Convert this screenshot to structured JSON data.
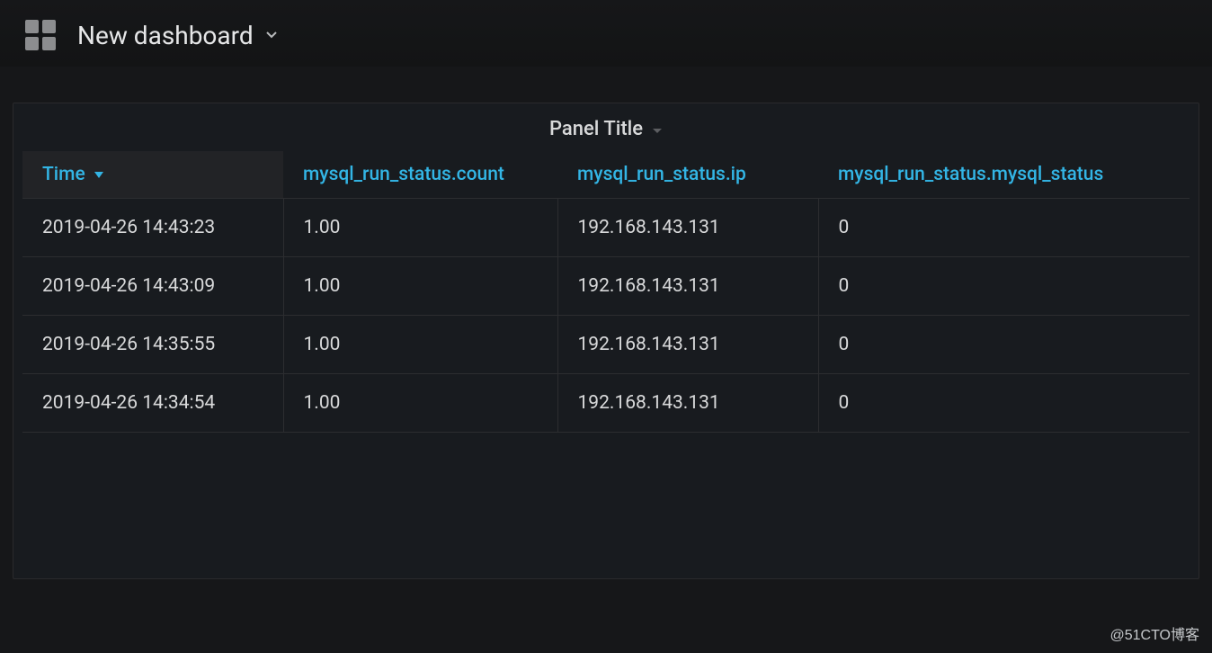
{
  "header": {
    "dashboard_title": "New dashboard"
  },
  "panel": {
    "title": "Panel Title",
    "columns": [
      {
        "label": "Time",
        "sorted": true
      },
      {
        "label": "mysql_run_status.count",
        "sorted": false
      },
      {
        "label": "mysql_run_status.ip",
        "sorted": false
      },
      {
        "label": "mysql_run_status.mysql_status",
        "sorted": false
      }
    ],
    "rows": [
      {
        "time": "2019-04-26 14:43:23",
        "count": "1.00",
        "ip": "192.168.143.131",
        "status": "0"
      },
      {
        "time": "2019-04-26 14:43:09",
        "count": "1.00",
        "ip": "192.168.143.131",
        "status": "0"
      },
      {
        "time": "2019-04-26 14:35:55",
        "count": "1.00",
        "ip": "192.168.143.131",
        "status": "0"
      },
      {
        "time": "2019-04-26 14:34:54",
        "count": "1.00",
        "ip": "192.168.143.131",
        "status": "0"
      }
    ]
  },
  "watermark": "@51CTO博客"
}
